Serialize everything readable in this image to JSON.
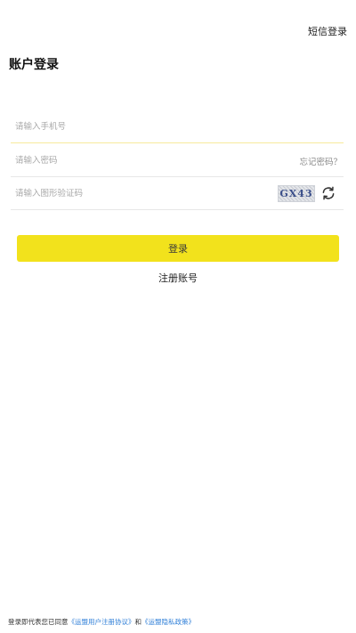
{
  "header": {
    "sms_login_label": "短信登录",
    "title": "账户登录"
  },
  "form": {
    "phone": {
      "value": "",
      "placeholder": "请输入手机号"
    },
    "password": {
      "value": "",
      "placeholder": "请输入密码",
      "forgot_label": "忘记密码？"
    },
    "captcha": {
      "value": "",
      "placeholder": "请输入图形验证码",
      "image_text": "GX43",
      "refresh_icon": "refresh-icon"
    },
    "login_label": "登录",
    "register_label": "注册账号"
  },
  "footer": {
    "prefix": "登录即代表您已同意",
    "user_agreement": "《运盟用户注册协议》",
    "conjunction": "和",
    "privacy_policy": "《运盟隐私政策》"
  },
  "colors": {
    "accent": "#f2e21c",
    "link": "#2f7fd8",
    "active_underline": "#f7ea9c"
  }
}
